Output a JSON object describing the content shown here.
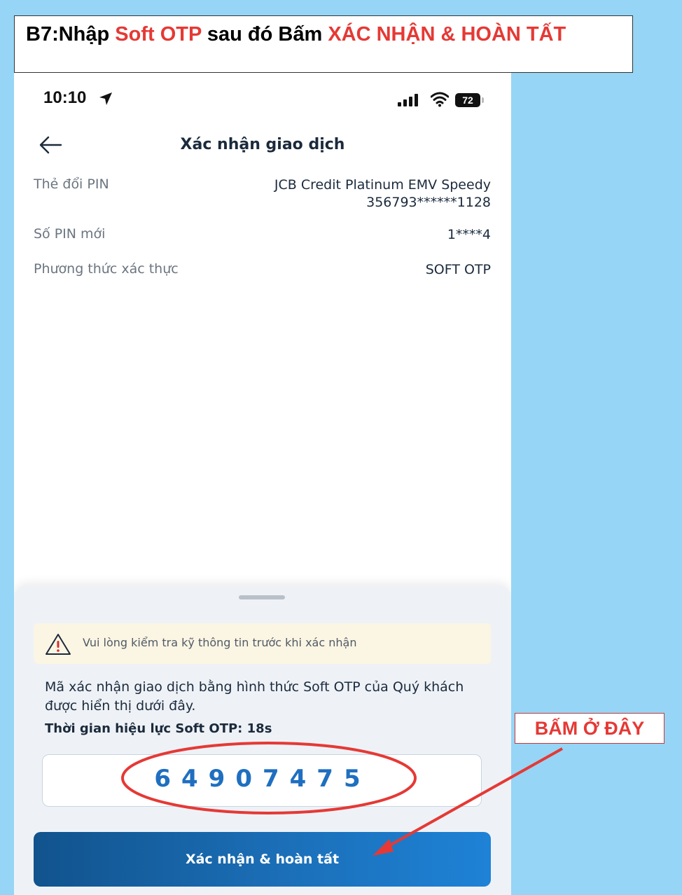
{
  "instruction": {
    "prefix": "B7:Nhập ",
    "highlight1": "Soft OTP",
    "middle": " sau đó Bấm ",
    "highlight2": "XÁC NHẬN & HOÀN TẤT"
  },
  "status_bar": {
    "time": "10:10",
    "battery": "72"
  },
  "header": {
    "title": "Xác nhận giao dịch"
  },
  "details": [
    {
      "label": "Thẻ đổi PIN",
      "value_line1": "JCB Credit Platinum EMV Speedy",
      "value_line2": "356793******1128"
    },
    {
      "label": "Số PIN mới",
      "value_line1": "1****4"
    },
    {
      "label": "Phương thức xác thực",
      "value_line1": "SOFT OTP"
    }
  ],
  "sheet": {
    "warning": "Vui lòng kiểm tra kỹ thông tin trước khi xác nhận",
    "description": "Mã xác nhận giao dịch bằng hình thức Soft OTP của Quý khách được hiển thị dưới đây.",
    "validity_label": "Thời gian hiệu lực Soft OTP:",
    "validity_value": "18s",
    "otp_code": "64907475",
    "confirm_label": "Xác nhận & hoàn tất"
  },
  "annotation": {
    "callout": "BẤM Ở ĐÂY",
    "color": "#e53935"
  },
  "colors": {
    "background": "#96d5f6",
    "accent": "#1f6fc0",
    "button": "#1b6fb8"
  }
}
